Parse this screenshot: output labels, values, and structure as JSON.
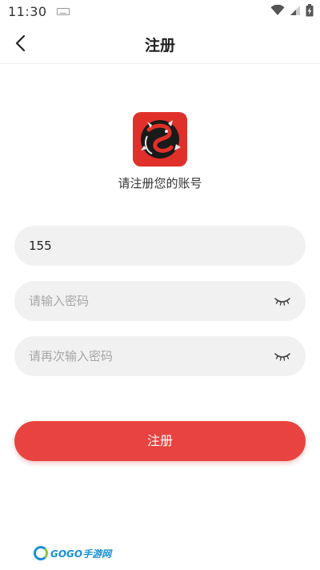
{
  "status_bar": {
    "time": "11:30",
    "icons": [
      "keyboard-icon",
      "wifi-icon",
      "signal-icon",
      "battery-charging-icon"
    ]
  },
  "header": {
    "title": "注册",
    "back_icon": "chevron-left-icon"
  },
  "main": {
    "subtitle": "请注册您的账号",
    "phone": {
      "value": "155",
      "placeholder": ""
    },
    "password": {
      "value": "",
      "placeholder": "请输入密码",
      "toggle_icon": "eye-closed-icon"
    },
    "confirm_password": {
      "value": "",
      "placeholder": "请再次输入密码",
      "toggle_icon": "eye-closed-icon"
    },
    "register_label": "注册"
  },
  "watermark": {
    "text": "GOGO手游网"
  },
  "colors": {
    "accent": "#e84340",
    "logo_bg": "#e0302a",
    "input_bg": "#f1f1f1",
    "placeholder": "#a6a6a6"
  }
}
